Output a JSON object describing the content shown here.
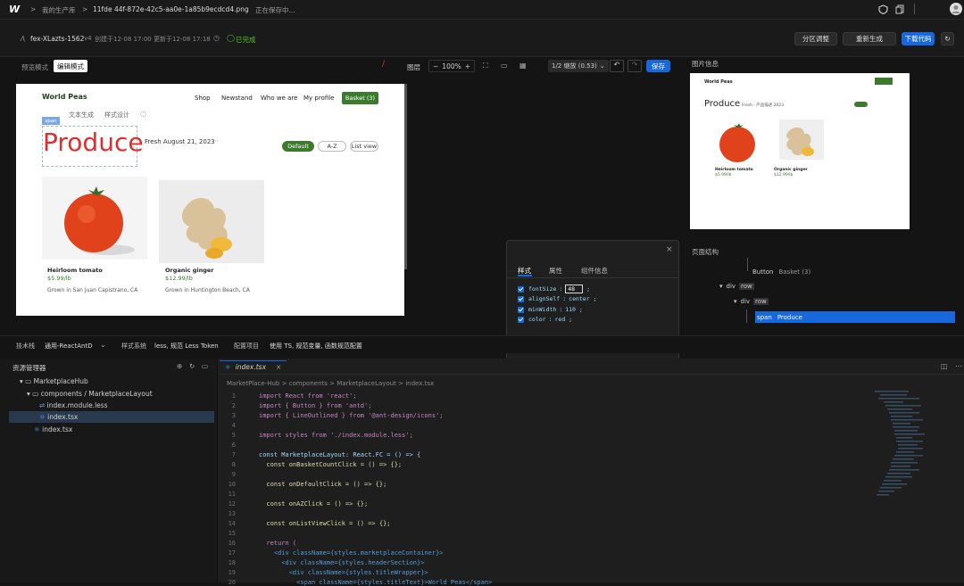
{
  "topbar": {
    "logo": "W",
    "crumbs": [
      ">",
      "我的生产库",
      ">",
      "11fde 44f-872e-42c5-aa0e-1a85b9ecdcd4.png",
      "正在保存中..."
    ]
  },
  "project": {
    "name": "fex-XLazts-1562",
    "version": "v4",
    "created": "创建于12-08 17:00",
    "updated": "更新于12-08 17:18",
    "status": "已完成",
    "buttons": {
      "partition": "分区调整",
      "regenerate": "重新生成",
      "download": "下载代码"
    }
  },
  "canvas_toolbar": {
    "tab_preview": "预览模式",
    "tab_edit": "编辑模式",
    "layer": "图层",
    "zoom": "100%",
    "ratio": "1/2 缩放 (0.53)",
    "save": "保存"
  },
  "preview": {
    "brand": "World Peas",
    "nav": [
      "Shop",
      "Newstand",
      "Who we are",
      "My profile"
    ],
    "basket": "Basket (3)",
    "tag": "span",
    "tools": [
      "文本生成",
      "样式设计"
    ],
    "heading": "Produce",
    "date": "Fresh August 21, 2023",
    "filters": [
      "Default",
      "A-Z",
      "List view"
    ],
    "products": [
      {
        "name": "Heirloom tomato",
        "price": "$5.99/lb",
        "origin": "Grown in San Juan Capistrano, CA"
      },
      {
        "name": "Organic ginger",
        "price": "$12.99/lb",
        "origin": "Grown in Huntington Beach, CA"
      }
    ]
  },
  "image_panel": {
    "title": "图片信息",
    "brand": "World Peas",
    "heading": "Produce",
    "sub": "Fresh · 产品描述 2023",
    "products": [
      {
        "name": "Heirloom tomato",
        "price": "$5.99/lb"
      },
      {
        "name": "Organic ginger",
        "price": "$12.99/lb"
      }
    ]
  },
  "popup": {
    "tabs": [
      "样式",
      "属性",
      "组件信息"
    ],
    "props": [
      {
        "key": "fontSize",
        "val": "48"
      },
      {
        "key": "alignSelf",
        "val": "center ;"
      },
      {
        "key": "minWidth",
        "val": "110 ;"
      },
      {
        "key": "color",
        "val": "red ;"
      }
    ]
  },
  "tree": {
    "title": "页面结构",
    "nodes": [
      {
        "label": "Button",
        "text": "Basket (3)"
      },
      {
        "label": "div",
        "text": "row"
      },
      {
        "label": "div",
        "text": "row"
      },
      {
        "label": "span",
        "text": "Produce"
      }
    ]
  },
  "techbar": {
    "items": [
      "技术栈",
      "通用-ReactAntD",
      "样式系统",
      "less, 规范 Less Token",
      "配置项目",
      "使用 TS, 规范变量, 函数规范配置"
    ]
  },
  "explorer": {
    "title": "资源管理器",
    "items": [
      "MarketplaceHub",
      "components / MarketplaceLayout",
      "index.module.less",
      "index.tsx",
      "index.tsx"
    ]
  },
  "editor": {
    "tab": "index.tsx",
    "breadcrumb": "MarketPlace-Hub > components > MarketplaceLayout > index.tsx",
    "lines": [
      "import React from 'react';",
      "import { Button } from 'antd';",
      "import { LineOutlined } from '@ant-design/icons';",
      "",
      "import styles from './index.module.less';",
      "",
      "const MarketplaceLayout: React.FC = () => {",
      "  const onBasketCountClick = () => {};",
      "",
      "  const onDefaultClick = () => {};",
      "",
      "  const onAZClick = () => {};",
      "",
      "  const onListViewClick = () => {};",
      "",
      "  return (",
      "    <div className={styles.marketplaceContainer}>",
      "      <div className={styles.headerSection}>",
      "        <div className={styles.titleWrapper}>",
      "          <span className={styles.titleText}>World Peas</span>"
    ]
  },
  "colors": {
    "accent": "#1668dc",
    "green": "#3c7a2e",
    "status": "#52c41a",
    "red": "#e02e2e"
  }
}
